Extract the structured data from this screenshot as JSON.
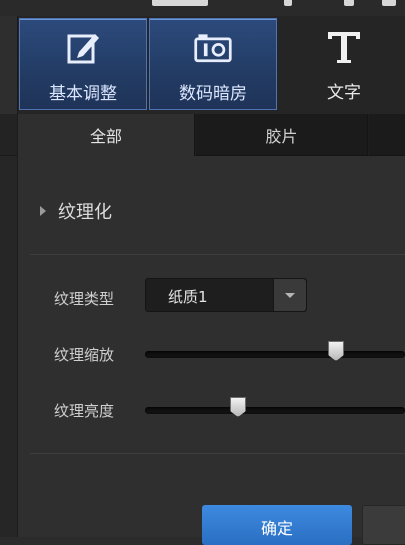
{
  "toolbar": {
    "items": [
      {
        "label": "基本调整",
        "icon": "edit-pencil-icon",
        "active": true
      },
      {
        "label": "数码暗房",
        "icon": "camera-icon",
        "active": true
      },
      {
        "label": "文字",
        "icon": "text-T-icon",
        "active": false
      }
    ]
  },
  "tabs": [
    {
      "label": "全部",
      "active": true
    },
    {
      "label": "胶片",
      "active": false
    }
  ],
  "section": {
    "title": "纹理化"
  },
  "texture_type": {
    "label": "纹理类型",
    "value": "纸质1"
  },
  "texture_scale": {
    "label": "纹理缩放",
    "level_percent": 73
  },
  "texture_brightness": {
    "label": "纹理亮度",
    "level_percent": 36
  },
  "confirm_button": {
    "label": "确定"
  },
  "colors": {
    "accent": "#2f77cf",
    "active_tool": "#2a4677"
  }
}
